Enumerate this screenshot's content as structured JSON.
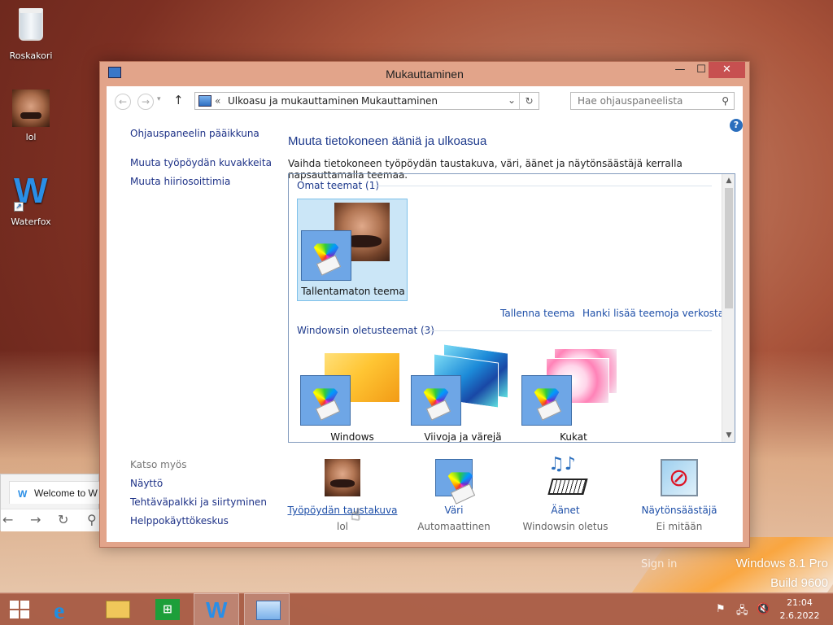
{
  "desktop": {
    "icons": [
      {
        "label": "Roskakori"
      },
      {
        "label": "lol"
      },
      {
        "label": "Waterfox"
      }
    ],
    "watermark": {
      "line1": "Windows 8.1 Pro",
      "line2": "Build 9600"
    },
    "signin": "Sign in"
  },
  "browser_peek": {
    "tab_title": "Welcome to W"
  },
  "window": {
    "title": "Mukauttaminen",
    "controls": {
      "minimize": "—",
      "maximize": "☐",
      "close": "✕"
    },
    "address": {
      "prefix": "«",
      "crumbs": [
        "Ulkoasu ja mukauttaminen",
        "Mukauttaminen"
      ],
      "separator": "›"
    },
    "search": {
      "placeholder": "Hae ohjauspaneelista"
    },
    "left_nav": [
      "Ohjauspaneelin pääikkuna",
      "Muuta työpöydän kuvakkeita",
      "Muuta hiiriosoittimia"
    ],
    "see_also": {
      "title": "Katso myös",
      "links": [
        "Näyttö",
        "Tehtäväpalkki ja siirtyminen",
        "Helppokäyttökeskus"
      ]
    },
    "heading": "Muuta tietokoneen ääniä ja ulkoasua",
    "subtext": "Vaihda tietokoneen työpöydän taustakuva, väri, äänet ja näytönsäästäjä kerralla napsauttamalla teemaa.",
    "my_themes": {
      "title": "Omat teemat (1)",
      "items": [
        {
          "name": "Tallentamaton teema",
          "selected": true
        }
      ]
    },
    "theme_links": {
      "save": "Tallenna teema",
      "more": "Hanki lisää teemoja verkosta"
    },
    "default_themes": {
      "title": "Windowsin oletusteemat (3)",
      "items": [
        {
          "name": "Windows"
        },
        {
          "name": "Viivoja ja värejä"
        },
        {
          "name": "Kukat"
        }
      ]
    },
    "bottom": [
      {
        "label": "Työpöydän taustakuva",
        "value": "lol",
        "icon": "wallpaper-icon"
      },
      {
        "label": "Väri",
        "value": "Automaattinen",
        "icon": "color-palette-icon"
      },
      {
        "label": "Äänet",
        "value": "Windowsin oletus",
        "icon": "sounds-icon"
      },
      {
        "label": "Näytönsäästäjä",
        "value": "Ei mitään",
        "icon": "screensaver-icon"
      }
    ]
  },
  "taskbar": {
    "clock": {
      "time": "21:04",
      "date": "2.6.2022"
    },
    "apps": [
      "start-icon",
      "internet-explorer-icon",
      "file-explorer-icon",
      "store-icon",
      "waterfox-icon",
      "control-panel-icon"
    ]
  }
}
